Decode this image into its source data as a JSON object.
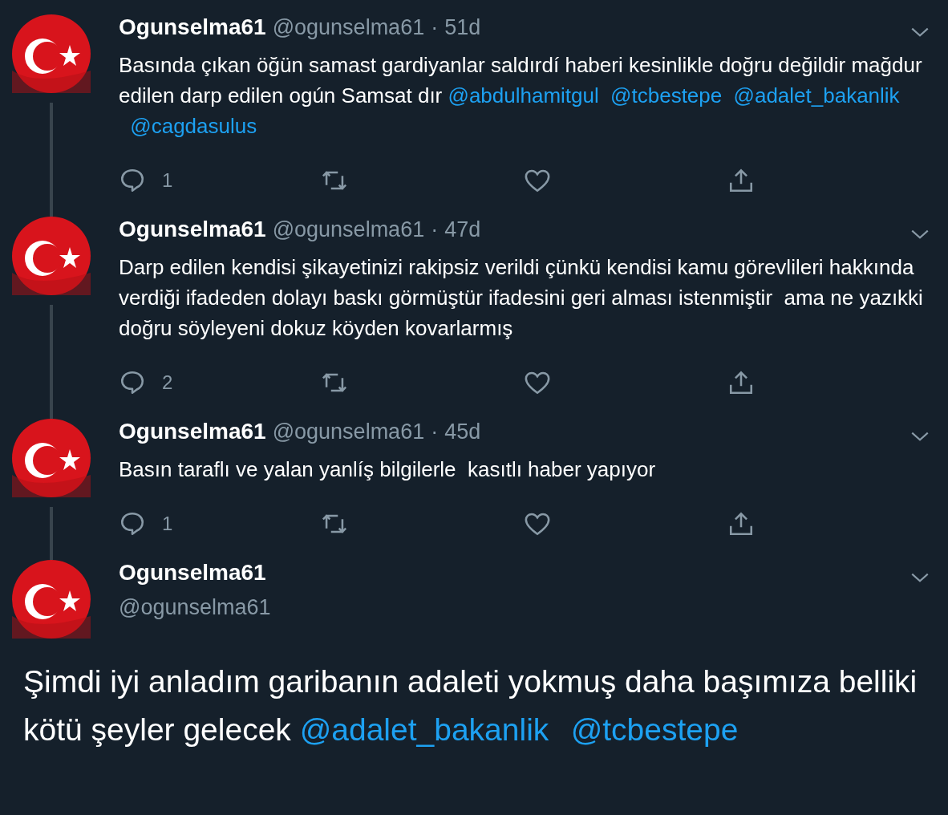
{
  "tweets": [
    {
      "name": "Ogunselma61",
      "handle": "@ogunselma61",
      "separator": "·",
      "time": "51d",
      "body": [
        {
          "kind": "text",
          "text": "Basında çıkan öğün samast gardiyanlar saldırdí haberi kesinlikle doğru değildir mağdur edilen darp edilen ogún Samsat dır "
        },
        {
          "kind": "mention",
          "text": "@abdulhamitgul"
        },
        {
          "kind": "mention",
          "text": "@tcbestepe"
        },
        {
          "kind": "mention",
          "text": "@adalet_bakanlik"
        },
        {
          "kind": "mention",
          "text": "@cagdasulus"
        }
      ],
      "replies": "1"
    },
    {
      "name": "Ogunselma61",
      "handle": "@ogunselma61",
      "separator": "·",
      "time": "47d",
      "body": [
        {
          "kind": "text",
          "text": "Darp edilen kendisi şikayetinizi rakipsiz verildi çünkü kendisi kamu görevlileri hakkında verdiği ifadeden dolayı baskı görmüştür ifadesini geri alması istenmiştir  ama ne yazıkki doğru söyleyeni dokuz köyden kovarlarmış"
        }
      ],
      "replies": "2"
    },
    {
      "name": "Ogunselma61",
      "handle": "@ogunselma61",
      "separator": "·",
      "time": "45d",
      "body": [
        {
          "kind": "text",
          "text": "Basın taraflı ve yalan yanlíş bilgilerle  kasıtlı haber yapıyor"
        }
      ],
      "replies": "1"
    }
  ],
  "main": {
    "name": "Ogunselma61",
    "handle": "@ogunselma61",
    "body": [
      {
        "kind": "text",
        "text": "Şimdi iyi anladım garibanın adaleti yokmuş daha başımıza belliki kötü şeyler gelecek "
      },
      {
        "kind": "mention",
        "text": "@adalet_bakanlik"
      },
      {
        "kind": "mention",
        "text": "@tcbestepe"
      }
    ]
  }
}
